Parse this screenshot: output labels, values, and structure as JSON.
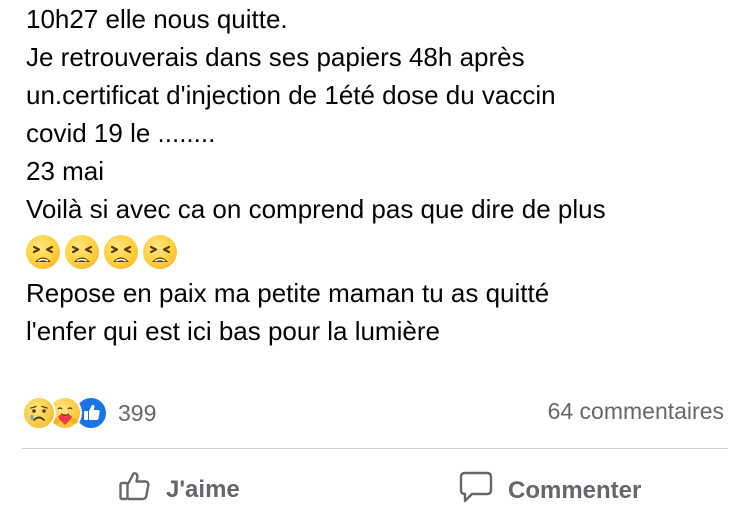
{
  "post": {
    "lines": [
      "10h27 elle nous quitte.",
      "Je retrouverais dans ses papiers 48h après",
      "un.certificat d'injection de 1été dose du vaccin",
      "covid 19 le ........",
      "23 mai",
      "Voilà si avec ca on comprend pas que dire de plus"
    ],
    "emojis": [
      "tired-face",
      "tired-face",
      "tired-face",
      "tired-face"
    ],
    "closing_lines": [
      "Repose en paix ma petite maman tu as quitté",
      "l'enfer qui est ici bas pour la lumière"
    ]
  },
  "stats": {
    "reaction_icons": [
      "sad-reaction",
      "care-reaction",
      "like-reaction"
    ],
    "reaction_count": "399",
    "comments_count": "64 commentaires"
  },
  "actions": {
    "like_label": "J'aime",
    "comment_label": "Commenter"
  },
  "colors": {
    "text": "#050505",
    "secondary": "#65676b",
    "like_blue": "#1b74e4",
    "divider": "#ced0d4"
  }
}
